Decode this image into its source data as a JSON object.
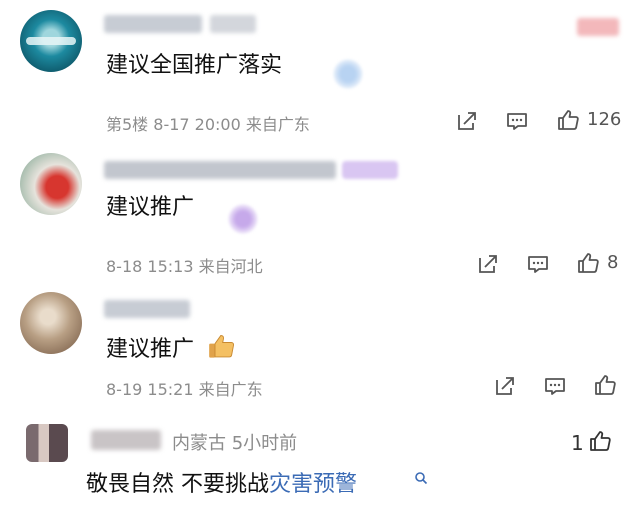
{
  "comments": [
    {
      "text": "建议全国推广落实",
      "meta": "第5楼 8-17 20:00 来自广东",
      "likes": "126"
    },
    {
      "text": "建议推广",
      "meta": "8-18 15:13 来自河北",
      "likes": "8"
    },
    {
      "text": "建议推广",
      "meta": "8-19 15:21 来自广东",
      "likes": ""
    }
  ],
  "last_comment": {
    "location_time": "内蒙古 5小时前",
    "text_plain": "敬畏自然 不要挑战",
    "text_link": "灾害预警",
    "likes": "1"
  },
  "colors": {
    "link": "#3b6bb5",
    "meta": "#8c8c8c"
  },
  "icons": [
    "share-icon",
    "comment-icon",
    "like-icon",
    "search-icon"
  ]
}
